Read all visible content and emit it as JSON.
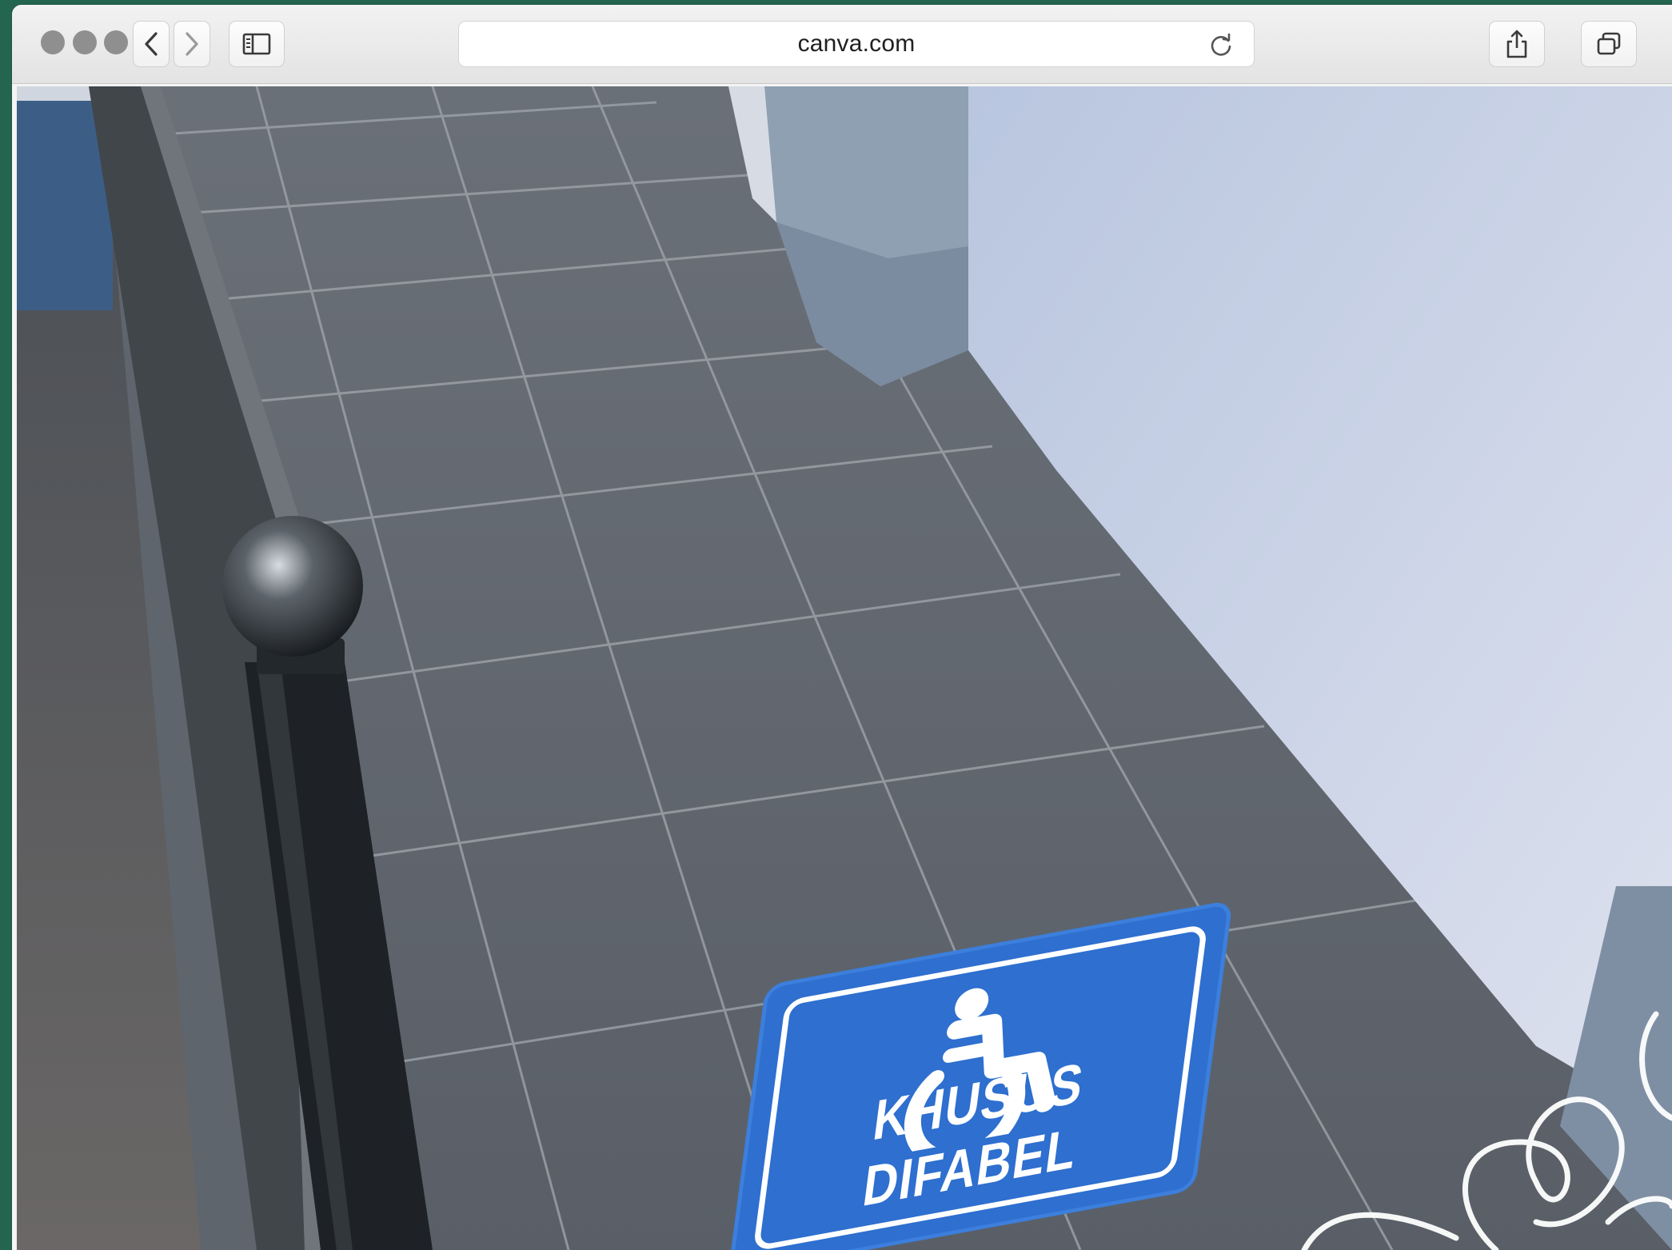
{
  "browser": {
    "url": "canva.com",
    "traffic_lights": [
      "close",
      "minimize",
      "zoom"
    ],
    "icons": {
      "back": "chevron-left-icon",
      "forward": "chevron-right-icon",
      "sidebar": "sidebar-icon",
      "reload": "reload-icon",
      "share": "share-icon",
      "tabs": "tabs-icon"
    }
  },
  "photo": {
    "sign_text": "KHUSUS DIFABEL",
    "sign_symbol": "wheelchair-icon",
    "colors": {
      "sign_blue": "#2e6fcf",
      "tile": "#62676f",
      "wall": "#c8d0e4",
      "frame_green": "#23654e"
    }
  }
}
